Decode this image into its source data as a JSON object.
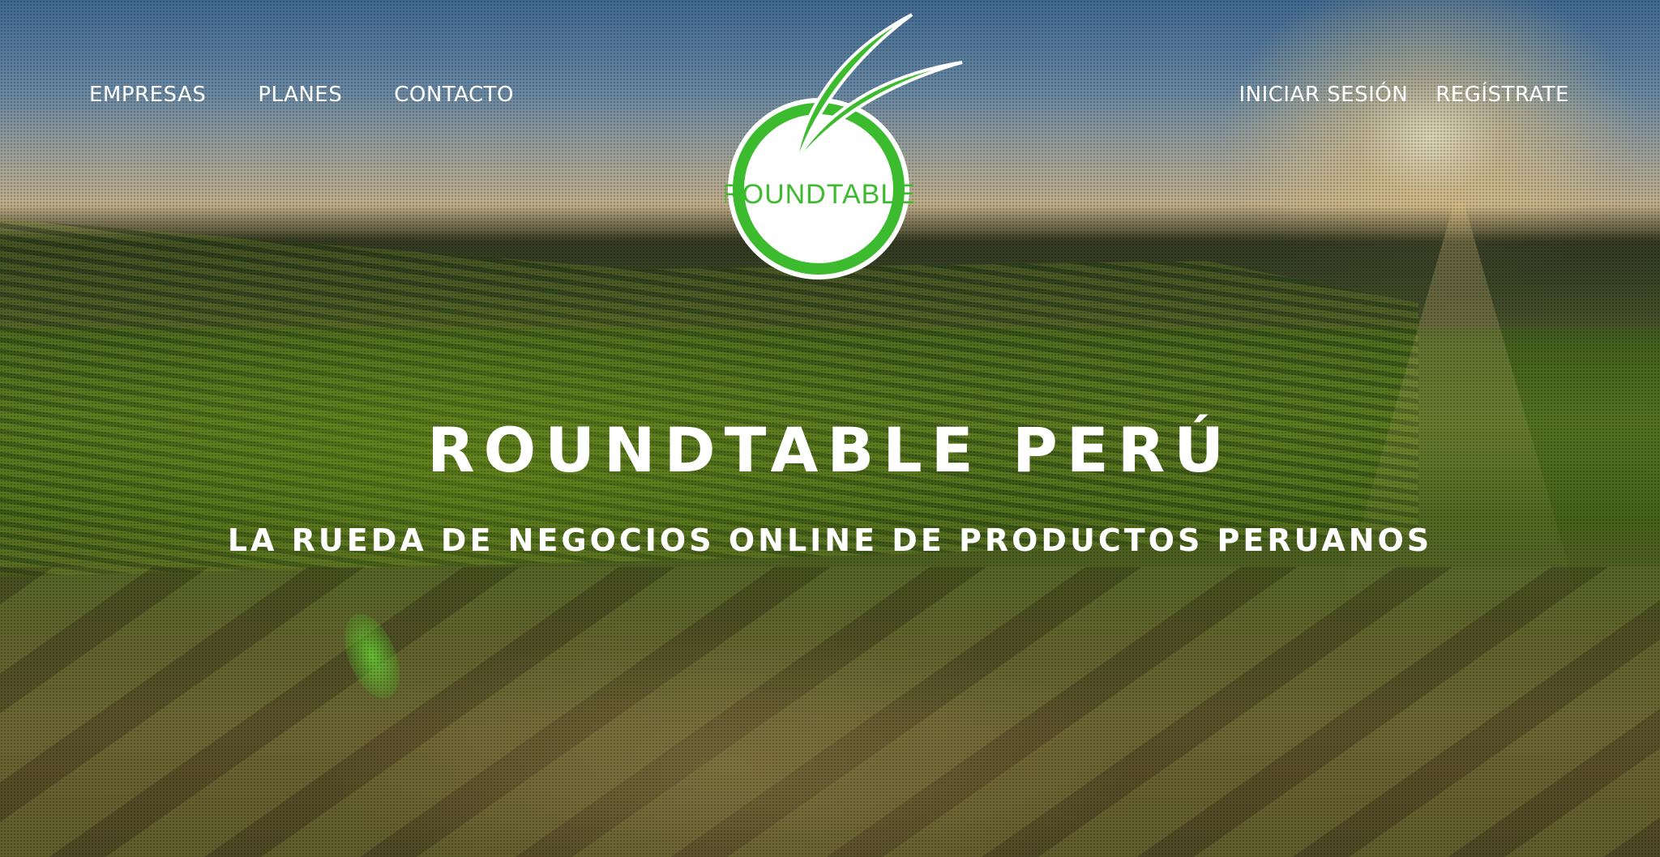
{
  "nav": {
    "left": [
      {
        "label": "EMPRESAS"
      },
      {
        "label": "PLANES"
      },
      {
        "label": "CONTACTO"
      }
    ],
    "right": [
      {
        "label": "INICIAR SESIÓN"
      },
      {
        "label": "REGÍSTRATE"
      }
    ]
  },
  "logo": {
    "text": "ROUNDTABLE",
    "colors": {
      "green": "#3dbb2e",
      "white": "#ffffff"
    }
  },
  "hero": {
    "title": "ROUNDTABLE PERÚ",
    "subtitle": "LA RUEDA DE NEGOCIOS ONLINE DE PRODUCTOS PERUANOS"
  },
  "colors": {
    "text": "#ffffff",
    "brand_green": "#3dbb2e"
  }
}
